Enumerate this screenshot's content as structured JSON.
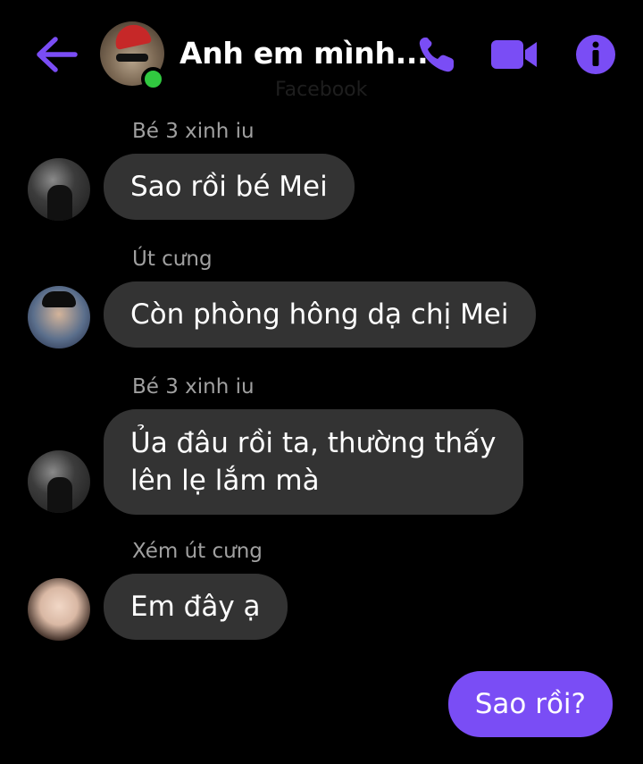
{
  "header": {
    "title": "Anh em mình...",
    "subtitle": "Facebook",
    "back_icon": "arrow-left-icon",
    "call_icon": "phone-icon",
    "video_icon": "video-camera-icon",
    "info_icon": "info-icon",
    "accent_color": "#7a4df5",
    "online_color": "#31c940"
  },
  "messages": [
    {
      "sender": "Bé 3 xinh iu",
      "text": "Sao rồi bé Mei",
      "incoming": true
    },
    {
      "sender": "Út cưng",
      "text": "Còn phòng hông dạ chị Mei",
      "incoming": true
    },
    {
      "sender": "Bé 3 xinh iu",
      "text_lines": [
        "Ủa đâu rồi ta, thường thấy",
        "lên lẹ lắm mà"
      ],
      "incoming": true
    },
    {
      "sender": "Xém út cưng",
      "text": "Em đây ạ",
      "incoming": true
    },
    {
      "text": "Sao rồi?",
      "incoming": false
    }
  ],
  "colors": {
    "incoming_bubble": "#333333",
    "outgoing_bubble": "#7a4df5",
    "sender_label": "#a0a0a0",
    "background": "#000000"
  }
}
